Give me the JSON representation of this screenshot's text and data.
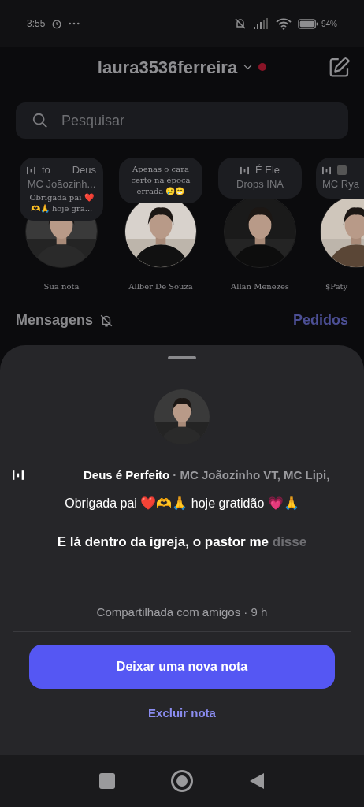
{
  "status_bar": {
    "time": "3:55",
    "battery": "94%"
  },
  "header": {
    "username": "laura3536ferreira",
    "unread": true
  },
  "search": {
    "placeholder": "Pesquisar"
  },
  "notes": [
    {
      "kind": "music",
      "title_parts": [
        "to",
        "Deus"
      ],
      "explicit": false,
      "artist": "MC Joãozinh...",
      "text": "Obrigada pai ❤️🫶🙏 hoje gra...",
      "name": "Sua nota"
    },
    {
      "kind": "text",
      "text": "Apenas o cara certo na época errada 🥲😁",
      "name": "Allber De Souza"
    },
    {
      "kind": "music",
      "title_parts": [
        "É Ele"
      ],
      "explicit": false,
      "artist": "Drops INA",
      "name": "Allan Menezes"
    },
    {
      "kind": "music",
      "explicit": true,
      "artist": "MC Rya",
      "name": "$Paty"
    }
  ],
  "section": {
    "title": "Mensagens",
    "muted": true,
    "requests": "Pedidos"
  },
  "sheet": {
    "song_title": "Deus é Perfeito",
    "artists": "· MC Joãozinho VT, MC Lipi,",
    "note": "Obrigada pai ❤️🫶🙏 hoje gratidão 💗🙏",
    "lyric_sung": "E lá dentro da igreja, o pastor me",
    "lyric_upcoming": "disse",
    "shared": "Compartilhada com amigos · 9 h",
    "primary_button": "Deixar uma nova nota",
    "secondary_button": "Excluir nota"
  }
}
